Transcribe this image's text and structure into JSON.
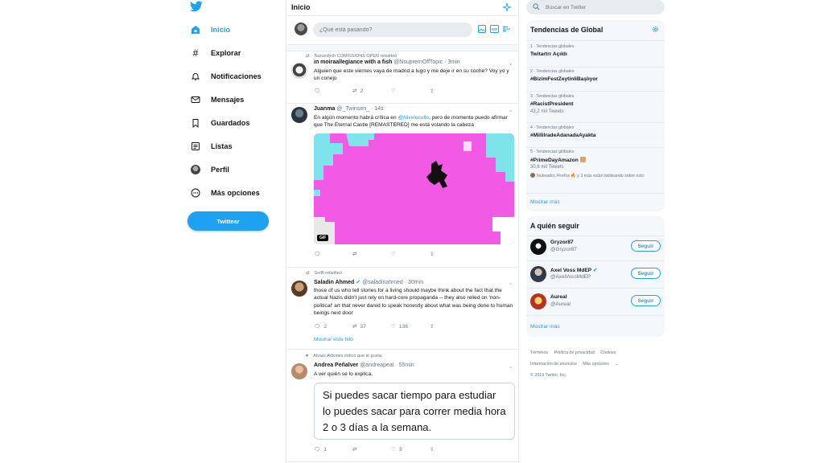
{
  "colors": {
    "accent": "#1da1f2",
    "text": "#14171a",
    "muted": "#657786",
    "border": "#e6ecf0",
    "panel": "#f5f8fa",
    "gif_bg": "#f25ae6",
    "gif_cyan": "#7fe3ec"
  },
  "nav": {
    "items": [
      {
        "label": "Inicio",
        "icon": "home-icon",
        "active": true
      },
      {
        "label": "Explorar",
        "icon": "hashtag-icon"
      },
      {
        "label": "Notificaciones",
        "icon": "bell-icon"
      },
      {
        "label": "Mensajes",
        "icon": "envelope-icon"
      },
      {
        "label": "Guardados",
        "icon": "bookmark-icon"
      },
      {
        "label": "Listas",
        "icon": "list-icon"
      },
      {
        "label": "Perfil",
        "icon": "avatar-icon"
      },
      {
        "label": "Más opciones",
        "icon": "more-circle-icon"
      }
    ],
    "tweet_button": "Twittear"
  },
  "feed": {
    "title": "Inicio",
    "composer_placeholder": "¿Qué está pasando?",
    "tweets": [
      {
        "social": "Naruedych COMISSIONS OPEN retwitteó",
        "name": "in moiraallegiance with a fish",
        "handle": "@NsupremOffTopic",
        "time": "· 3min",
        "text": "Alguien que este viernes vaya de madrid a lugo y me deje ir en su coche? Voy yo y un conejo",
        "retweets": "2"
      },
      {
        "name": "Juanma",
        "handle": "@_Twinsen_",
        "time": "· 14s",
        "text_pre": "En algún momento habrá crítica en ",
        "text_link": "@Nivelocullo",
        "text_post": ", pero de momento puedo afirmar que The Eternal Castle [REMASTERED] me está volando la cabeza",
        "gif_badge": "GIF"
      },
      {
        "social": "Sniffi retwitteó",
        "name": "Saladin Ahmed",
        "handle": "@saladinahmed",
        "time": "· 30min",
        "text": "those of us who tell stories for a living should maybe think about the fact that the actual Nazis didn't just rely on hard-core propaganda -- they also relied on 'non-political' art that never dared to speak honestly about what was being done to human beings next door",
        "replies": "2",
        "retweets": "37",
        "likes": "136",
        "show_thread": "Mostrar este hilo"
      },
      {
        "social": "Alvaro Arbonés indicó que le gusta",
        "name": "Andrea Peñalver",
        "handle": "@andreapeal",
        "time": "· 55min",
        "text": "A ver quién se lo explica.",
        "quote": "Si puedes sacar tiempo para estudiar lo puedes sacar para correr media hora 2 o 3 días a la semana.",
        "replies": "1",
        "likes": "3"
      }
    ]
  },
  "search": {
    "placeholder": "Buscar en Twitter"
  },
  "trends": {
    "title": "Tendencias de Global",
    "items": [
      {
        "cat": "1 · Tendencias globales",
        "name": "Twitartrr Açıldı",
        "count": ""
      },
      {
        "cat": "2 · Tendencias globales",
        "name": "#BizimFestZeytinliBaşlıyor",
        "count": ""
      },
      {
        "cat": "3 · Tendencias globales",
        "name": "#RacistPresident",
        "count": "43,2 mil Tweets"
      },
      {
        "cat": "4 · Tendencias globales",
        "name": "#MillilradeAdanadaAyakta",
        "count": ""
      },
      {
        "cat": "5 · Tendencias globales",
        "name": "#PrimeDayAmazon",
        "count": "30,6 mil Tweets"
      }
    ],
    "trend5_extra": "Nukeador, Firefox 🔥 y 3 más están twitteando sobre esto",
    "show_more": "Mostrar más"
  },
  "who_to_follow": {
    "title": "A quién seguir",
    "items": [
      {
        "name": "Gryzor87",
        "handle": "@Gryzor87",
        "button": "Seguir"
      },
      {
        "name": "Axel Voss MdEP",
        "handle": "@AxelVossMdEP",
        "button": "Seguir"
      },
      {
        "name": "Aureal",
        "handle": "@Aureal",
        "button": "Seguir"
      }
    ],
    "show_more": "Mostrar más"
  },
  "footer": {
    "links": [
      "Términos",
      "Política de privacidad",
      "Cookies",
      "Información de anuncios",
      "Más opciones"
    ],
    "copyright": "© 2019 Twitter, Inc."
  }
}
